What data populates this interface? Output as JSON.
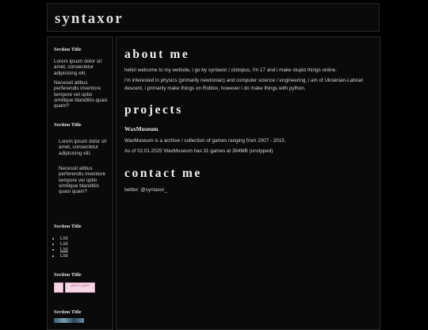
{
  "header": {
    "site_title": "syntaxor"
  },
  "sidebar": {
    "sections": [
      {
        "title": "Section Title",
        "paragraphs": [
          "Lorem ipsum dolor sit amet, consectetur adipisicing elit.",
          "Necessit atibus perferendis inventore tempore vel optio similique blanditiis quasi quam?"
        ]
      },
      {
        "title": "Section Title",
        "paragraphs": [
          "Lorem ipsum dolor sit amet, consectetur adipisicing elit.",
          "Necessit atibus perferendis inventore tempore vel optio similique blanditiis quasi quam?"
        ]
      },
      {
        "title": "Section Title",
        "list": [
          "List",
          "List",
          "List",
          "List"
        ]
      },
      {
        "title": "Section Title",
        "badges": [
          "",
          "persi w pixel"
        ]
      },
      {
        "title": "Section Title"
      }
    ]
  },
  "main": {
    "about": {
      "heading": "about me",
      "p1": "hello! welcome to my website, i go by syntaxor / cistopus, i'm 17 and i make stupid things online.",
      "p2": "i'm interested in physics (primarily newtonian) and computer science / engineering, i am of Ukrainian-Latvian descent, i primarily make things on Roblox, however i do make things with python."
    },
    "projects": {
      "heading": "projects",
      "item_title": "WaxMuseum",
      "p1": "WaxMuseum is a archive / collection of games ranging from 2007 - 2015.",
      "p2": "As of 02.01.2025 WaxMuseum has 31 games at 364MB (unzipped)"
    },
    "contact": {
      "heading": "contact me",
      "twitter": "twitter: @syntaxor_"
    }
  },
  "colors": {
    "background": "#000000",
    "panel": "#0a0a0a",
    "border": "#2a2a2a",
    "text": "#d4d4d4",
    "badge_pink": "#f5d6e4"
  }
}
